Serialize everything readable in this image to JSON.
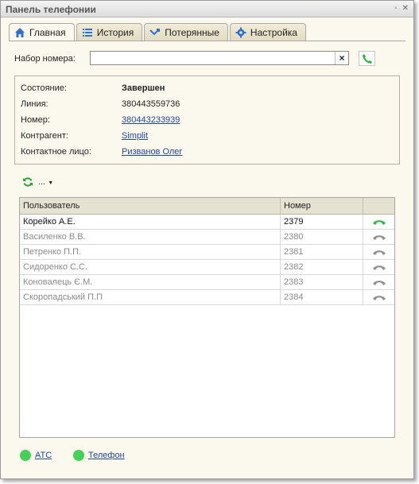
{
  "window": {
    "title": "Панель телефонии"
  },
  "tabs": [
    {
      "label": "Главная",
      "icon": "home-icon",
      "active": true
    },
    {
      "label": "История",
      "icon": "list-icon",
      "active": false
    },
    {
      "label": "Потерянные",
      "icon": "missed-call-icon",
      "active": false
    },
    {
      "label": "Настройка",
      "icon": "gear-icon",
      "active": false
    }
  ],
  "dial": {
    "label": "Набор номера:",
    "value": "",
    "clear": "×"
  },
  "info": {
    "state_label": "Состояние:",
    "state_value": "Завершен",
    "line_label": "Линия:",
    "line_value": "380443559736",
    "number_label": "Номер:",
    "number_value": "380443233939",
    "contractor_label": "Контрагент:",
    "contractor_value": "Simplit",
    "contact_label": "Контактное лицо:",
    "contact_value": "Ризванов Олег"
  },
  "toolbar": {
    "more_label": "..."
  },
  "grid": {
    "headers": [
      "Пользователь",
      "Номер",
      ""
    ],
    "rows": [
      {
        "user": "Корейко А.Е.",
        "number": "2379",
        "active": true
      },
      {
        "user": "Василенко В.В.",
        "number": "2380",
        "active": false
      },
      {
        "user": "Петренко П.П.",
        "number": "2381",
        "active": false
      },
      {
        "user": "Сидоренко С.С.",
        "number": "2382",
        "active": false
      },
      {
        "user": "Коновалець Є.М.",
        "number": "2383",
        "active": false
      },
      {
        "user": "Скоропадський П.П",
        "number": "2384",
        "active": false
      }
    ]
  },
  "statusbar": [
    {
      "label": "АТС",
      "color": "#45d157"
    },
    {
      "label": "Телефон",
      "color": "#45d157"
    }
  ],
  "colors": {
    "accent_green": "#2db83d",
    "inactive_gray": "#8f8f8f",
    "link": "#1f45a6"
  }
}
